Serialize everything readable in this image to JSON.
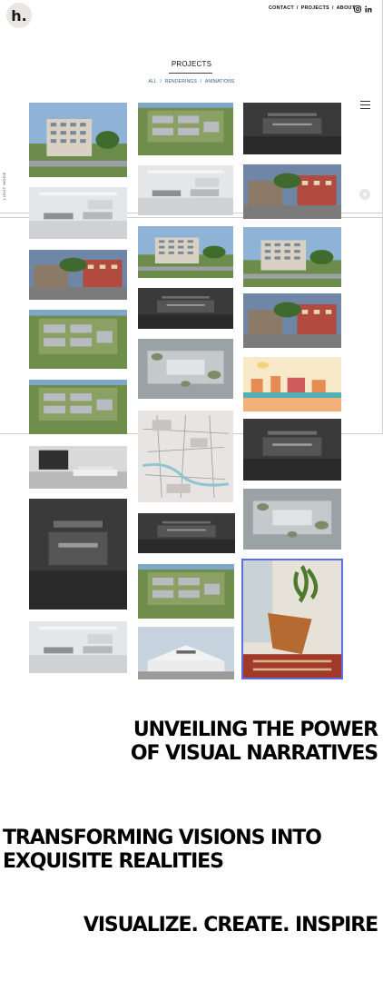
{
  "header": {
    "logo_text": "h.",
    "nav": [
      {
        "label": "CONTACT"
      },
      {
        "label": "PROJECTS"
      },
      {
        "label": "ABOUT"
      }
    ],
    "nav_separator": "/",
    "social_icons": [
      "instagram-icon",
      "linkedin-icon"
    ]
  },
  "projects": {
    "title": "PROJECTS",
    "filters": [
      "ALL",
      "RENDERINGS",
      "ANIMATIONS"
    ],
    "filter_separator": "/"
  },
  "side_label": "LIGHT MODE",
  "menu_icon": "hamburger-icon",
  "scroll_top_icon": "arrow-up-icon",
  "gallery": [
    {
      "name": "project-tile-apartment-tower",
      "scene": "building-day"
    },
    {
      "name": "project-tile-office-open",
      "scene": "interior-light"
    },
    {
      "name": "project-tile-street-people",
      "scene": "street-red"
    },
    {
      "name": "project-tile-campus-aerial",
      "scene": "aerial-green"
    },
    {
      "name": "project-tile-site-aerial",
      "scene": "aerial-green"
    },
    {
      "name": "project-tile-living-room",
      "scene": "interior-grey"
    },
    {
      "name": "project-tile-bedroom",
      "scene": "interior-dark"
    },
    {
      "name": "project-tile-clinic",
      "scene": "interior-light"
    },
    {
      "name": "project-tile-rail-aerial",
      "scene": "aerial-green"
    },
    {
      "name": "project-tile-office-desk",
      "scene": "interior-light"
    },
    {
      "name": "project-tile-plaza",
      "scene": "building-day"
    },
    {
      "name": "project-tile-kitchen-dark",
      "scene": "interior-dark"
    },
    {
      "name": "project-tile-mall-aerial",
      "scene": "aerial-grey"
    },
    {
      "name": "project-tile-site-plan",
      "scene": "plan"
    },
    {
      "name": "project-tile-device-dark",
      "scene": "interior-dark"
    },
    {
      "name": "project-tile-industrial-aerial",
      "scene": "aerial-green"
    },
    {
      "name": "project-tile-warehouse",
      "scene": "building-white"
    },
    {
      "name": "project-tile-green-wall",
      "scene": "interior-dark"
    },
    {
      "name": "project-tile-town-square",
      "scene": "street-red"
    },
    {
      "name": "project-tile-palm-road",
      "scene": "building-day"
    },
    {
      "name": "project-tile-evening-street",
      "scene": "street-red"
    },
    {
      "name": "project-tile-illustration",
      "scene": "illustration"
    },
    {
      "name": "project-tile-courtyard",
      "scene": "interior-dark"
    },
    {
      "name": "project-tile-garden-plan",
      "scene": "aerial-grey"
    },
    {
      "name": "project-tile-butterfly-chair",
      "scene": "chair"
    }
  ],
  "headlines": [
    {
      "line1": "UNVEILING THE POWER",
      "line2": "OF VISUAL NARRATIVES"
    },
    {
      "line1": "TRANSFORMING VISIONS INTO",
      "line2": "EXQUISITE REALITIES"
    },
    {
      "line1": "VISUALIZE. CREATE. INSPIRE",
      "line2": ""
    }
  ],
  "colors": {
    "accent": "#2a5d8a",
    "selection": "#5b6ee8",
    "text": "#111111"
  }
}
